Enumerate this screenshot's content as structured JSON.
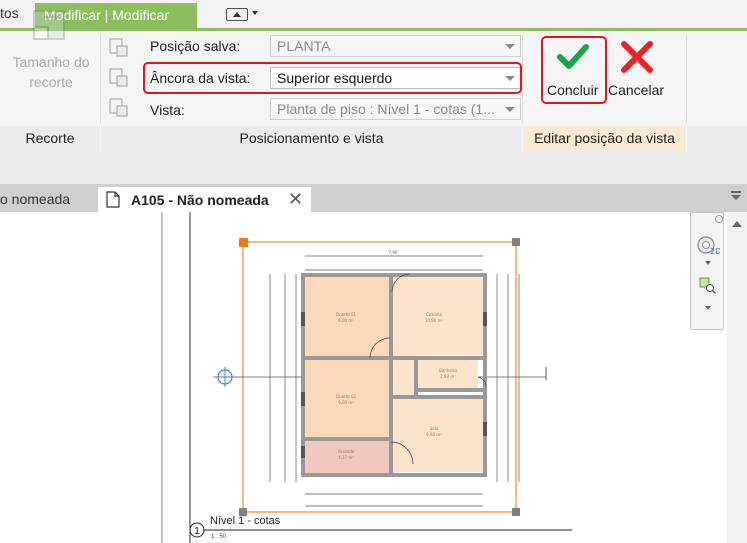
{
  "ribbon": {
    "prev_tab": "tos",
    "active_tab": "Modificar | Modificar",
    "crop": {
      "size_label": "Tamanho do recorte",
      "panel_title": "Recorte"
    },
    "saved_position": {
      "label": "Posição salva:",
      "value": "PLANTA"
    },
    "view_anchor": {
      "label": "Âncora da vista:",
      "value": "Superior esquerdo"
    },
    "view": {
      "label": "Vista:",
      "value": "Planta de piso : Nível 1 - cotas (1..."
    },
    "placement_panel_title": "Posicionamento e vista",
    "finish_button": "Concluir",
    "cancel_button": "Cancelar",
    "edit_panel_title": "Editar posição da vista"
  },
  "document_tabs": {
    "prev_tab": "o nomeada",
    "active_tab": "A105 - Não nomeada"
  },
  "view_title": {
    "number": "1",
    "name": "Nível 1 - cotas",
    "scale": "1 : 50"
  },
  "icons": {
    "crop": "crop-size-icon",
    "saved": "saved-position-icon",
    "anchor": "anchor-icon",
    "view": "view-icon",
    "finish": "green-check-icon",
    "cancel": "red-x-icon",
    "doc": "sheet-doc-icon",
    "close": "close-tab-icon",
    "steering_wheel": "steering-wheel-2d-icon",
    "zoom": "zoom-region-icon"
  },
  "colors": {
    "ribbon_accent": "#8cbf5c",
    "highlight": "#e2171e",
    "check": "#1aa34a",
    "cancel": "#e8232a",
    "viewport_border": "#ee8a1a",
    "room_fill": "#fbd9b8",
    "room_pink": "#f1c8c0"
  }
}
